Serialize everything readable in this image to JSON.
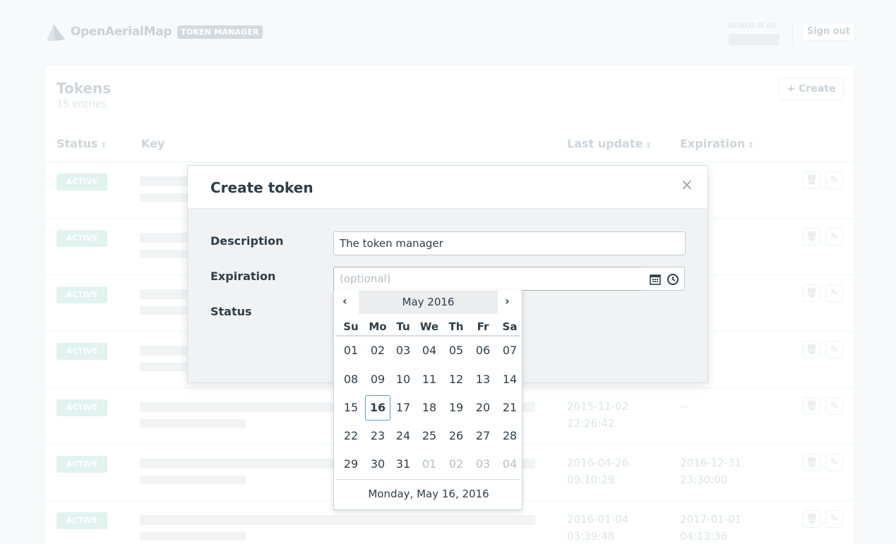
{
  "header": {
    "brand": "OpenAerialMap",
    "badge": "TOKEN MANAGER",
    "signed_in_label": "SIGNED IN AS",
    "sign_out": "Sign out"
  },
  "panel": {
    "title": "Tokens",
    "subtitle": "15 entries",
    "create_label": "Create",
    "columns": [
      "Status",
      "Key",
      "Last update",
      "Expiration"
    ]
  },
  "rows": [
    {
      "status": "ACTIVE",
      "last_update": "",
      "expiration": ""
    },
    {
      "status": "ACTIVE",
      "last_update": "",
      "expiration": ""
    },
    {
      "status": "ACTIVE",
      "last_update": "",
      "expiration": ""
    },
    {
      "status": "ACTIVE",
      "last_update": "",
      "expiration": ""
    },
    {
      "status": "ACTIVE",
      "last_update": "2015-11-02\n22:26:42",
      "expiration": "--"
    },
    {
      "status": "ACTIVE",
      "last_update": "2016-04-26\n09:10:29",
      "expiration": "2016-12-31\n23:30:00"
    },
    {
      "status": "ACTIVE",
      "last_update": "2016-01-04\n03:39:48",
      "expiration": "2017-01-01\n04:13:36"
    }
  ],
  "modal": {
    "title": "Create token",
    "close": "×",
    "description_label": "Description",
    "description_value": "The token manager",
    "expiration_label": "Expiration",
    "expiration_placeholder": "(optional)",
    "status_label": "Status"
  },
  "picker": {
    "prev": "‹",
    "next": "›",
    "month": "May 2016",
    "weekdays": [
      "Su",
      "Mo",
      "Tu",
      "We",
      "Th",
      "Fr",
      "Sa"
    ],
    "weeks": [
      [
        "01",
        "02",
        "03",
        "04",
        "05",
        "06",
        "07"
      ],
      [
        "08",
        "09",
        "10",
        "11",
        "12",
        "13",
        "14"
      ],
      [
        "15",
        "16",
        "17",
        "18",
        "19",
        "20",
        "21"
      ],
      [
        "22",
        "23",
        "24",
        "25",
        "26",
        "27",
        "28"
      ],
      [
        "29",
        "30",
        "31",
        "01",
        "02",
        "03",
        "04"
      ]
    ],
    "muted_from": [
      4,
      3
    ],
    "today_cell": [
      2,
      1
    ],
    "footer": "Monday, May 16, 2016"
  },
  "colors": {
    "accent": "#5b9bd5",
    "active_badge": "#e1f3ee"
  }
}
